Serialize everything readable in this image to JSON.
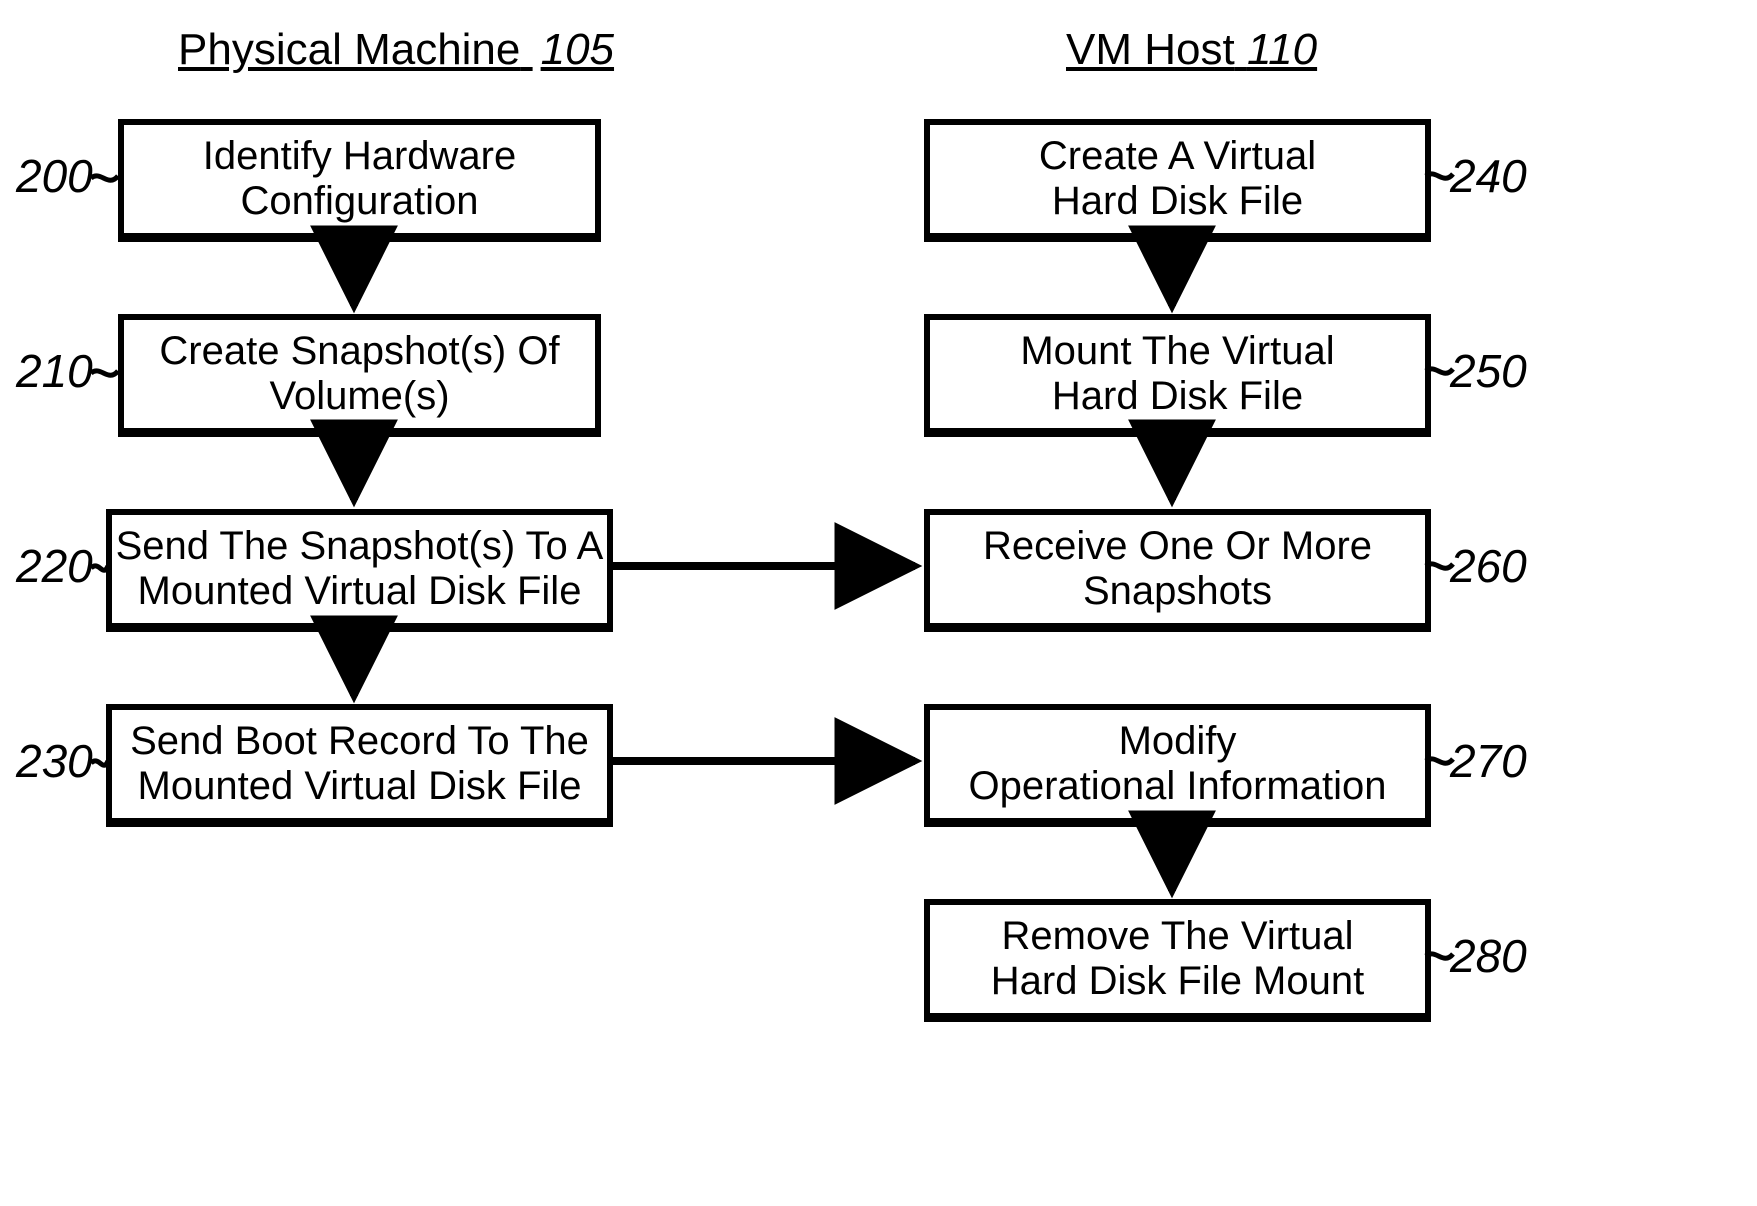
{
  "headings": {
    "left": {
      "text": "Physical Machine",
      "num": "105"
    },
    "right": {
      "text": "VM Host",
      "num": " 110"
    }
  },
  "refs": {
    "r200": "200",
    "r210": "210",
    "r220": "220",
    "r230": "230",
    "r240": "240",
    "r250": "250",
    "r260": "260",
    "r270": "270",
    "r280": "280"
  },
  "boxes": {
    "b200": {
      "l1": "Identify Hardware",
      "l2": "Configuration"
    },
    "b210": {
      "l1": "Create Snapshot(s) Of",
      "l2": "Volume(s)"
    },
    "b220": {
      "l1": "Send The Snapshot(s) To A",
      "l2": "Mounted Virtual Disk File"
    },
    "b230": {
      "l1": "Send Boot Record To The",
      "l2": "Mounted Virtual Disk File"
    },
    "b240": {
      "l1": "Create A Virtual",
      "l2": "Hard Disk File"
    },
    "b250": {
      "l1": "Mount The Virtual",
      "l2": "Hard Disk File"
    },
    "b260": {
      "l1": "Receive One Or More",
      "l2": "Snapshots"
    },
    "b270": {
      "l1": "Modify",
      "l2": "Operational Information"
    },
    "b280": {
      "l1": "Remove The Virtual",
      "l2": "Hard Disk File Mount"
    }
  }
}
